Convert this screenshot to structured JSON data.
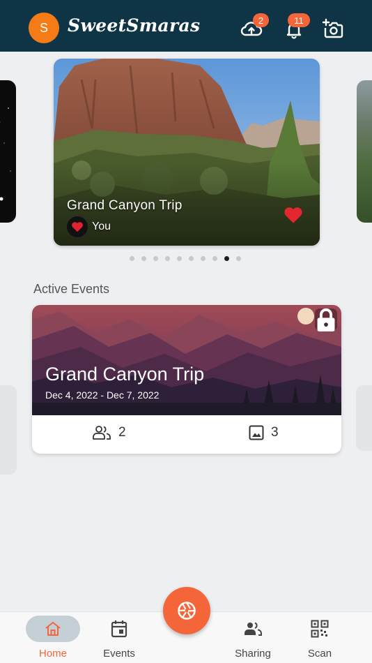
{
  "header": {
    "avatar_initial": "S",
    "brand": "SweetSmaras",
    "upload_badge": "2",
    "notification_badge": "11",
    "icons": [
      "cloud-upload-icon",
      "bell-icon",
      "add-photo-icon"
    ]
  },
  "carousel": {
    "main_card": {
      "title": "Grand Canyon Trip",
      "owner": "You"
    },
    "total_dots": 10,
    "active_dot": 8
  },
  "active_events": {
    "section_title": "Active Events",
    "events": [
      {
        "title": "Grand Canyon Trip",
        "dates": "Dec 4, 2022 - Dec 7, 2022",
        "members": "2",
        "photos": "3",
        "locked": true
      }
    ]
  },
  "bottom_nav": {
    "items": [
      {
        "label": "Home",
        "icon": "home-icon",
        "active": true
      },
      {
        "label": "Events",
        "icon": "calendar-icon",
        "active": false
      },
      {
        "label": "Sharing",
        "icon": "people-icon",
        "active": false
      },
      {
        "label": "Scan",
        "icon": "qr-code-icon",
        "active": false
      }
    ],
    "fab_icon": "camera-shutter-icon"
  },
  "colors": {
    "header_bg": "#0f3445",
    "accent": "#f4653a",
    "avatar": "#f47b16",
    "page_bg": "#eeeff1"
  }
}
